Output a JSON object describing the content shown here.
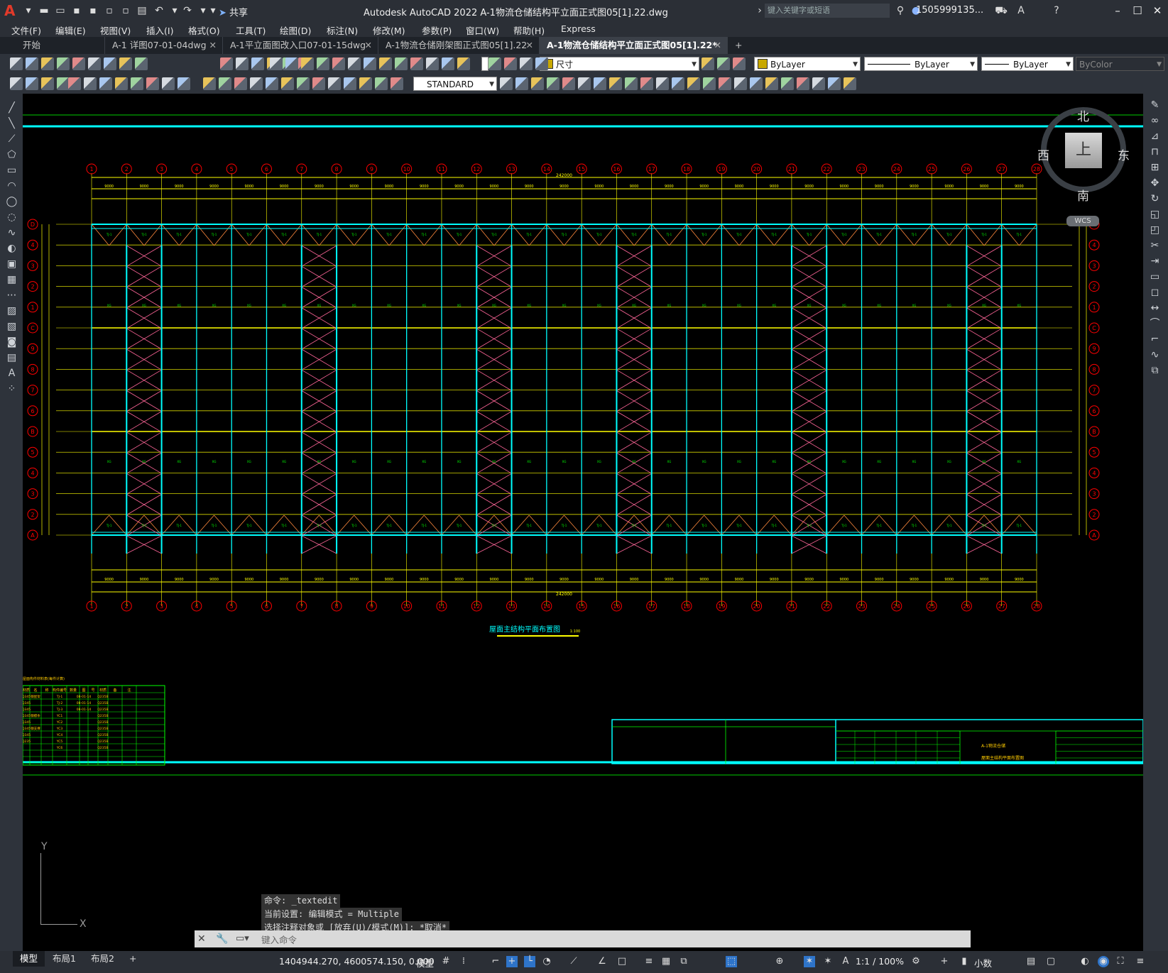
{
  "app": {
    "title": "Autodesk AutoCAD 2022   A-1物流仓储结构平立面正式图05[1].22.dwg",
    "logo": "A",
    "share_label": "共享",
    "search_placeholder": "键入关键字或短语",
    "user": "1505999135...",
    "help": "?"
  },
  "menu": [
    "文件(F)",
    "编辑(E)",
    "视图(V)",
    "插入(I)",
    "格式(O)",
    "工具(T)",
    "绘图(D)",
    "标注(N)",
    "修改(M)",
    "参数(P)",
    "窗口(W)",
    "帮助(H)",
    "Express"
  ],
  "tabs": [
    {
      "label": "开始",
      "active": false,
      "closable": false
    },
    {
      "label": "A-1 详图07-01-04dwg",
      "active": false,
      "closable": true
    },
    {
      "label": "A-1平立面图改入口07-01-15dwg",
      "active": false,
      "closable": true
    },
    {
      "label": "A-1物流仓储刚架图正式图05[1].22",
      "active": false,
      "closable": true
    },
    {
      "label": "A-1物流仓储结构平立面正式图05[1].22*",
      "active": true,
      "closable": true
    }
  ],
  "toolbar": {
    "layer_combo": "尺寸",
    "color_combo": "ByLayer",
    "linetype_combo": "ByLayer",
    "lineweight_combo": "ByLayer",
    "plotstyle_combo": "ByColor",
    "textstyle_combo": "STANDARD"
  },
  "viewcube": {
    "north": "北",
    "south": "南",
    "east": "东",
    "west": "西",
    "top": "上",
    "wcs": "WCS"
  },
  "drawing": {
    "overall_dim": "242000",
    "bay_dim": "9000",
    "grid_count": 28,
    "row_labels_left": [
      "D",
      "4",
      "3",
      "2",
      "1",
      "C",
      "9",
      "8",
      "7",
      "6",
      "B",
      "5",
      "4",
      "3",
      "2",
      "A"
    ],
    "title": "屋面主结构平面布置图",
    "scale": "1:100",
    "material_table_title": "屋面构件材料表(每件计算)",
    "material_headers": [
      "材质",
      "名",
      "称",
      "构件编号",
      "数量",
      "图",
      "号",
      "材质",
      "备",
      "注"
    ],
    "material_rows": [
      [
        "Q345",
        "钢屋架",
        "",
        "TJ-1",
        "",
        "08-01-14",
        "",
        "Q235B",
        "",
        ""
      ],
      [
        "Q345",
        "",
        "",
        "TJ-2",
        "",
        "08-01-14",
        "",
        "Q235B",
        "",
        ""
      ],
      [
        "Q345",
        "",
        "",
        "TJ-3",
        "",
        "08-01-14",
        "",
        "Q235B",
        "",
        ""
      ],
      [
        "Q345",
        "钢檩条",
        "",
        "YC1",
        "",
        "",
        "",
        "Q235B",
        "",
        ""
      ],
      [
        "Q345",
        "",
        "",
        "YC2",
        "",
        "",
        "",
        "Q235B",
        "",
        ""
      ],
      [
        "Q345",
        "钢支撑",
        "",
        "YC3",
        "",
        "",
        "",
        "Q235B",
        "",
        ""
      ],
      [
        "Q345",
        "",
        "",
        "YC4",
        "",
        "",
        "",
        "Q235B",
        "",
        ""
      ],
      [
        "Q235",
        "",
        "",
        "YC5",
        "",
        "",
        "",
        "Q235B",
        "",
        ""
      ],
      [
        "",
        "",
        "",
        "YC6",
        "",
        "",
        "",
        "Q235B",
        "",
        ""
      ]
    ],
    "titleblock_project": "A-1物流仓储",
    "titleblock_drawing": "屋面主结构平面布置图"
  },
  "command": {
    "history": [
      "命令: _textedit",
      "当前设置: 编辑模式 = Multiple",
      "选择注释对象或 [放弃(U)/模式(M)]: *取消*"
    ],
    "placeholder": "键入命令"
  },
  "status": {
    "layouts": [
      "模型",
      "布局1",
      "布局2"
    ],
    "coords": "1404944.270, 4600574.150, 0.000",
    "space": "模型",
    "scale": "1:1 / 100%",
    "units": "小数"
  },
  "ucs": {
    "y": "Y",
    "x": "X"
  },
  "colors": {
    "grid_cyan": "#00ffff",
    "grid_red": "#ff0000",
    "dim_yellow": "#ffff00",
    "text_green": "#00ff00",
    "brace_pink": "#ff6699",
    "chrome": "#2b2f36"
  }
}
